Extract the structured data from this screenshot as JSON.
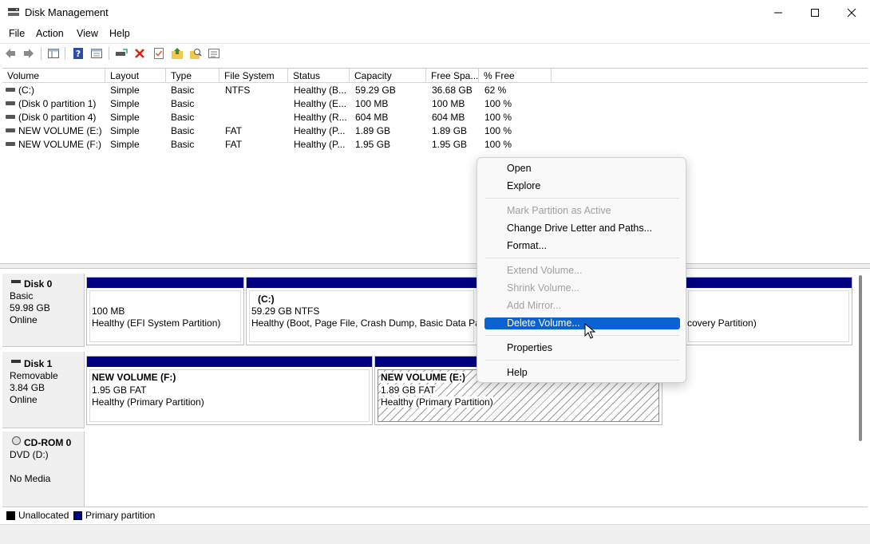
{
  "window": {
    "title": "Disk Management",
    "icons": [
      "app-icon",
      "minimize-icon",
      "maximize-icon",
      "close-icon"
    ]
  },
  "menubar": {
    "file": "File",
    "action": "Action",
    "view": "View",
    "help": "Help"
  },
  "toolbar": {
    "icons": [
      "back-arrow-icon",
      "forward-arrow-icon",
      "console-tree-icon",
      "help-book-icon",
      "properties-pane-icon",
      "connect-disk-icon",
      "delete-x-icon",
      "properties-check-icon",
      "folder-up-icon",
      "search-folder-icon",
      "details-list-icon"
    ]
  },
  "volume_list": {
    "columns": [
      "Volume",
      "Layout",
      "Type",
      "File System",
      "Status",
      "Capacity",
      "Free Spa...",
      "% Free"
    ],
    "rows": [
      [
        "(C:)",
        "Simple",
        "Basic",
        "NTFS",
        "Healthy (B...",
        "59.29 GB",
        "36.68 GB",
        "62 %"
      ],
      [
        "(Disk 0 partition 1)",
        "Simple",
        "Basic",
        "",
        "Healthy (E...",
        "100 MB",
        "100 MB",
        "100 %"
      ],
      [
        "(Disk 0 partition 4)",
        "Simple",
        "Basic",
        "",
        "Healthy (R...",
        "604 MB",
        "604 MB",
        "100 %"
      ],
      [
        "NEW VOLUME (E:)",
        "Simple",
        "Basic",
        "FAT",
        "Healthy (P...",
        "1.89 GB",
        "1.89 GB",
        "100 %"
      ],
      [
        "NEW VOLUME (F:)",
        "Simple",
        "Basic",
        "FAT",
        "Healthy (P...",
        "1.95 GB",
        "1.95 GB",
        "100 %"
      ]
    ]
  },
  "disks": {
    "disk0": {
      "name": "Disk 0",
      "type": "Basic",
      "size": "59.98 GB",
      "state": "Online",
      "p1": {
        "line1": "100 MB",
        "line2": "Healthy (EFI System Partition)"
      },
      "p2": {
        "title": "(C:)",
        "line1": "59.29 GB NTFS",
        "line2": "Healthy (Boot, Page File, Crash Dump, Basic Data Part"
      },
      "p3": {
        "line2": "covery Partition)"
      }
    },
    "disk1": {
      "name": "Disk 1",
      "type": "Removable",
      "size": "3.84 GB",
      "state": "Online",
      "p1": {
        "title": "NEW VOLUME  (F:)",
        "line1": "1.95 GB FAT",
        "line2": "Healthy (Primary Partition)"
      },
      "p2": {
        "title": "NEW VOLUME  (E:)",
        "line1": "1.89 GB FAT",
        "line2": "Healthy (Primary Partition)"
      }
    },
    "cdrom0": {
      "name": "CD-ROM 0",
      "type": "DVD (D:)",
      "state": "No Media"
    }
  },
  "legend": {
    "unallocated": "Unallocated",
    "primary": "Primary partition",
    "colors": {
      "unallocated": "#000000",
      "primary": "#000080"
    }
  },
  "context_menu": {
    "open": "Open",
    "explore": "Explore",
    "mark_active": "Mark Partition as Active",
    "change_letter": "Change Drive Letter and Paths...",
    "format": "Format...",
    "extend": "Extend Volume...",
    "shrink": "Shrink Volume...",
    "add_mirror": "Add Mirror...",
    "delete": "Delete Volume...",
    "properties": "Properties",
    "help": "Help",
    "highlight_color": "#0A63D1"
  }
}
